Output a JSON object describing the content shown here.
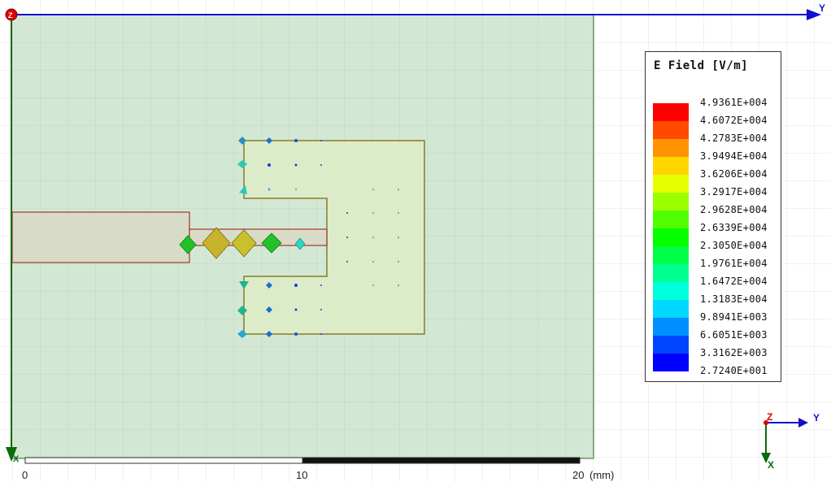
{
  "axes": {
    "y_label": "Y",
    "z_label": "Z",
    "x_label": "X"
  },
  "legend": {
    "title": "E Field [V/m]",
    "colors": [
      "#ff0000",
      "#ff4a00",
      "#ff9400",
      "#ffd500",
      "#e6ff00",
      "#9cff00",
      "#52ff00",
      "#05ff00",
      "#00ff47",
      "#00ff91",
      "#00ffdb",
      "#00d8ff",
      "#008fff",
      "#0045ff",
      "#0000ff"
    ],
    "values": [
      "4.9361E+004",
      "4.6072E+004",
      "4.2783E+004",
      "3.9494E+004",
      "3.6206E+004",
      "3.2917E+004",
      "2.9628E+004",
      "2.6339E+004",
      "2.3050E+004",
      "1.9761E+004",
      "1.6472E+004",
      "1.3183E+004",
      "9.8941E+003",
      "6.6051E+003",
      "3.3162E+003",
      "2.7240E+001"
    ]
  },
  "scale_bar": {
    "ticks": [
      "0",
      "10",
      "20"
    ],
    "unit": "(mm)"
  },
  "colors": {
    "substrate": "#d3e8d4",
    "patch": "#dcecc8",
    "axis_y": "#1010cc",
    "axis_x": "#0a6b0a",
    "axis_z": "#dd0000"
  }
}
